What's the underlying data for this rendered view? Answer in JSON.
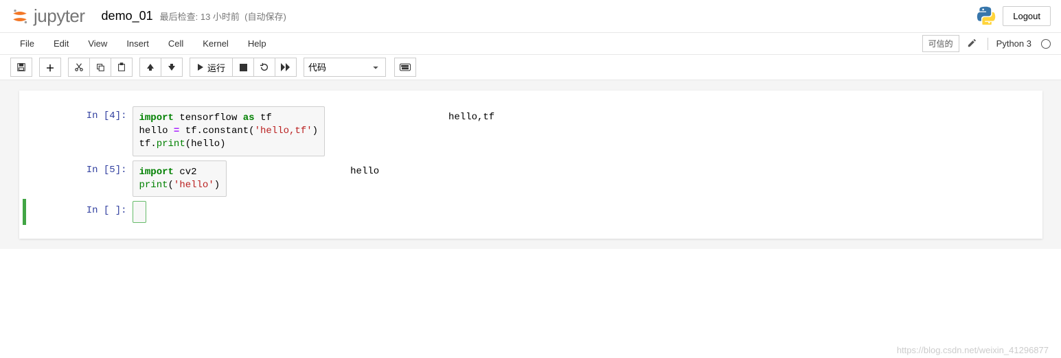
{
  "header": {
    "brand_text": "jupyter",
    "notebook_name": "demo_01",
    "checkpoint_label": "最后检查: 13 小时前",
    "autosave_label": "(自动保存)",
    "logout_label": "Logout"
  },
  "menubar": {
    "items": [
      "File",
      "Edit",
      "View",
      "Insert",
      "Cell",
      "Kernel",
      "Help"
    ],
    "trusted_label": "可信的",
    "kernel_name": "Python 3"
  },
  "toolbar": {
    "run_label": "运行",
    "cell_type_selected": "代码"
  },
  "cells": [
    {
      "prompt": "In  [4]:",
      "code_html": "<span class='cm-keyword'>import</span> <span class='cm-variable'>tensorflow</span> <span class='cm-keyword'>as</span> <span class='cm-variable'>tf</span>\n<span class='cm-variable'>hello</span> <span class='cm-operator'>=</span> <span class='cm-variable'>tf</span>.<span class='cm-variable'>constant</span>(<span class='cm-string'>'hello,tf'</span>)\n<span class='cm-variable'>tf</span>.<span class='cm-builtin'>print</span>(<span class='cm-variable'>hello</span>)",
      "output": "hello,tf",
      "selected": false
    },
    {
      "prompt": "In  [5]:",
      "code_html": "<span class='cm-keyword'>import</span> <span class='cm-variable'>cv2</span>\n<span class='cm-builtin'>print</span>(<span class='cm-string'>'hello'</span>)",
      "output": "hello",
      "selected": false
    },
    {
      "prompt": "In  [ ]:",
      "code_html": "",
      "output": "",
      "selected": true
    }
  ],
  "watermark": "https://blog.csdn.net/weixin_41296877"
}
